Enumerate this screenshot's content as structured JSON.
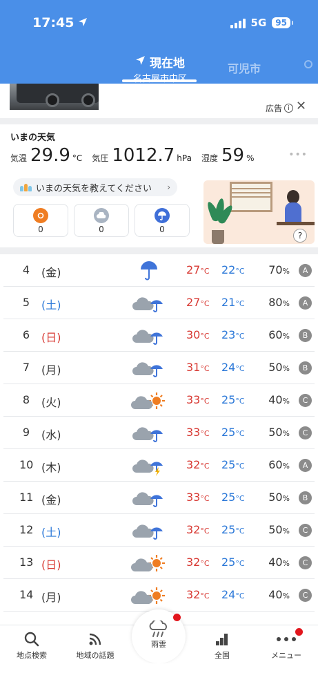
{
  "status_bar": {
    "time": "17:45",
    "network": "5G",
    "battery": "95"
  },
  "location_tabs": {
    "active_title": "現在地",
    "active_sub": "名古屋市中区",
    "next": "可児市"
  },
  "ad": {
    "label": "広告"
  },
  "current": {
    "title": "いまの天気",
    "temp_label": "気温",
    "temp_value": "29.9",
    "temp_unit": "°C",
    "pressure_label": "気圧",
    "pressure_value": "1012.7",
    "pressure_unit": "hPa",
    "humidity_label": "湿度",
    "humidity_value": "59",
    "humidity_unit": "%",
    "report_prompt": "いまの天気を教えてください",
    "reports": [
      {
        "icon": "sun-icon",
        "count": "0",
        "color": "#ef7d22"
      },
      {
        "icon": "cloud-icon",
        "count": "0",
        "color": "#a9b4c2"
      },
      {
        "icon": "rain-icon",
        "count": "0",
        "color": "#3f6fd8"
      }
    ]
  },
  "forecast": [
    {
      "day": "4",
      "dow": "(金)",
      "type": "wk",
      "icon": "rain",
      "hi": "27",
      "lo": "22",
      "pop": "70",
      "rank": "A"
    },
    {
      "day": "5",
      "dow": "(土)",
      "type": "sat",
      "icon": "cloud-rain",
      "hi": "27",
      "lo": "21",
      "pop": "80",
      "rank": "A"
    },
    {
      "day": "6",
      "dow": "(日)",
      "type": "sun",
      "icon": "cloud-rain",
      "hi": "30",
      "lo": "23",
      "pop": "60",
      "rank": "B"
    },
    {
      "day": "7",
      "dow": "(月)",
      "type": "wk",
      "icon": "cloud-rain",
      "hi": "31",
      "lo": "24",
      "pop": "50",
      "rank": "B"
    },
    {
      "day": "8",
      "dow": "(火)",
      "type": "wk",
      "icon": "cloud-sun",
      "hi": "33",
      "lo": "25",
      "pop": "40",
      "rank": "C"
    },
    {
      "day": "9",
      "dow": "(水)",
      "type": "wk",
      "icon": "cloud-rain",
      "hi": "33",
      "lo": "25",
      "pop": "50",
      "rank": "C"
    },
    {
      "day": "10",
      "dow": "(木)",
      "type": "wk",
      "icon": "cloud-thunder",
      "hi": "32",
      "lo": "25",
      "pop": "60",
      "rank": "A"
    },
    {
      "day": "11",
      "dow": "(金)",
      "type": "wk",
      "icon": "cloud-rain",
      "hi": "33",
      "lo": "25",
      "pop": "50",
      "rank": "B"
    },
    {
      "day": "12",
      "dow": "(土)",
      "type": "sat",
      "icon": "cloud-rain",
      "hi": "32",
      "lo": "25",
      "pop": "50",
      "rank": "C"
    },
    {
      "day": "13",
      "dow": "(日)",
      "type": "sun",
      "icon": "cloud-sun",
      "hi": "32",
      "lo": "25",
      "pop": "40",
      "rank": "C"
    },
    {
      "day": "14",
      "dow": "(月)",
      "type": "wk",
      "icon": "cloud-sun",
      "hi": "32",
      "lo": "24",
      "pop": "40",
      "rank": "C"
    }
  ],
  "units": {
    "temp": "°C",
    "pop": "%"
  },
  "bottom_nav": {
    "search": "地点検索",
    "topics": "地域の話題",
    "rain": "雨雲",
    "national": "全国",
    "menu": "メニュー"
  },
  "colors": {
    "header": "#4a8fe8",
    "high": "#d83a34",
    "low": "#2b78d8",
    "badge": "#e2161d"
  }
}
